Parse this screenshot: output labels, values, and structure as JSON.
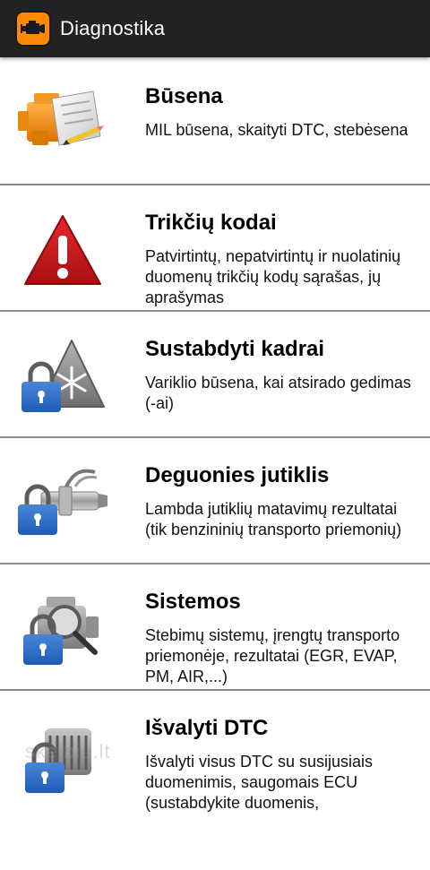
{
  "app": {
    "title": "Diagnostika",
    "accent": "#ff8a00",
    "bar_color": "#222222"
  },
  "items": [
    {
      "title": "Būsena",
      "description": "MIL būsena, skaityti DTC, stebėsena",
      "icon": "engine-document-icon",
      "locked": false
    },
    {
      "title": "Trikčių kodai",
      "description": "Patvirtintų, nepatvirtintų ir nuolatinių duomenų trikčių kodų sąrašas, jų aprašymas",
      "icon": "warning-icon",
      "locked": false
    },
    {
      "title": "Sustabdyti kadrai",
      "description": "Variklio būsena, kai atsirado gedimas (-ai)",
      "icon": "snowflake-warning-icon",
      "locked": true
    },
    {
      "title": "Deguonies jutiklis",
      "description": "Lambda jutiklių matavimų rezultatai (tik benzininių transporto priemonių)",
      "icon": "oxygen-sensor-icon",
      "locked": true
    },
    {
      "title": "Sistemos",
      "description": "Stebimų sistemų, įrengtų transporto priemonėje, rezultatai (EGR, EVAP, PM, AIR,...)",
      "icon": "engine-magnifier-icon",
      "locked": true
    },
    {
      "title": "Išvalyti DTC",
      "description": "Išvalyti visus DTC su susijusiais duomenimis, saugomais ECU (sustabdykite duomenis,",
      "icon": "engine-clear-icon",
      "locked": true
    }
  ],
  "watermark": "skelbiu.lt"
}
